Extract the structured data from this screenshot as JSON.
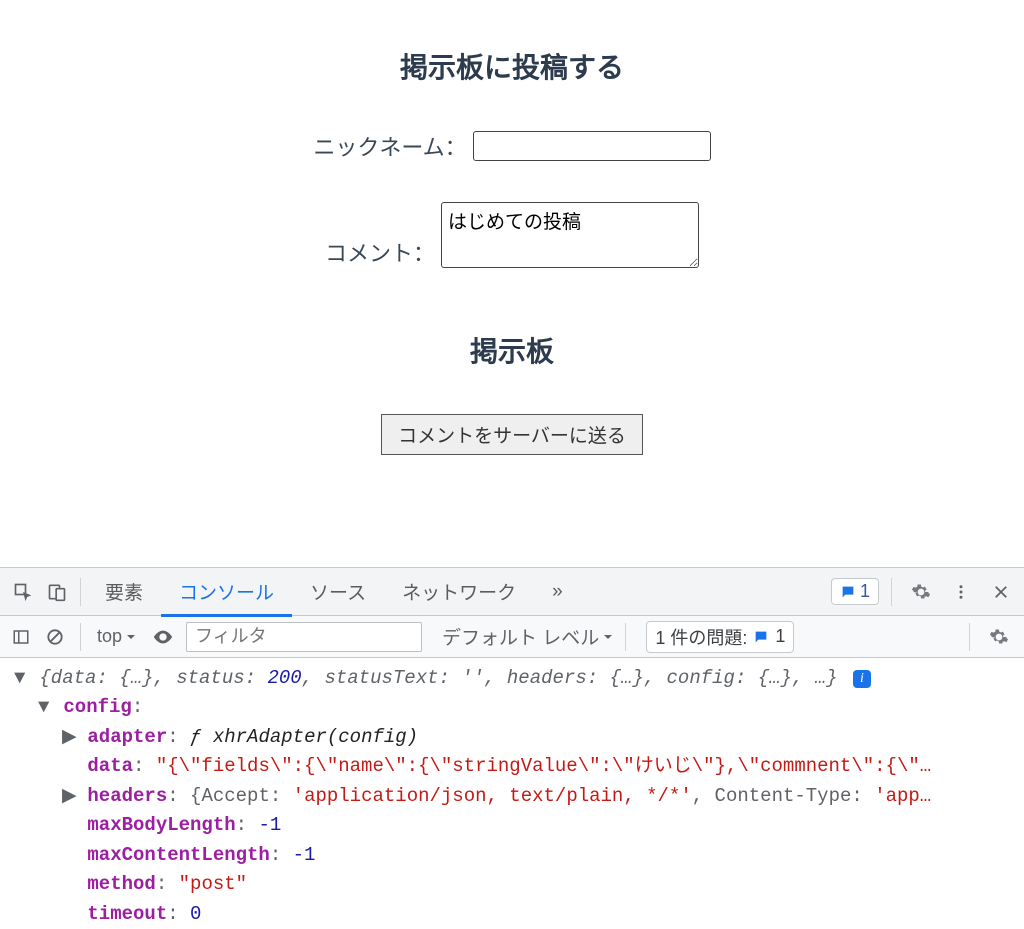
{
  "page": {
    "heading_post": "掲示板に投稿する",
    "nickname_label": "ニックネーム：",
    "nickname_value": "",
    "comment_label": "コメント：",
    "comment_value": "はじめての投稿",
    "heading_board": "掲示板",
    "submit_label": "コメントをサーバーに送る"
  },
  "devtools": {
    "tabs": {
      "elements": "要素",
      "console": "コンソール",
      "sources": "ソース",
      "network": "ネットワーク",
      "more": "»"
    },
    "badge_count": "1",
    "subbar": {
      "context": "top",
      "filter_placeholder": "フィルタ",
      "level": "デフォルト レベル",
      "issues_label": "1 件の問題:",
      "issues_count": "1"
    }
  },
  "console": {
    "line_top_prefix": "{data: {…}, status: ",
    "status": "200",
    "line_top_mid": ", statusText: '', headers: {…}, config: {…}, …}",
    "config_key": "config",
    "adapter_key": "adapter",
    "adapter_val": "ƒ xhrAdapter(config)",
    "data_key": "data",
    "data_val": "\"{\\\"fields\\\":{\\\"name\\\":{\\\"stringValue\\\":\\\"けいじ\\\"},\\\"commnent\\\":{\\\"…",
    "headers_key": "headers",
    "headers_open": "{",
    "headers_accept_k": "Accept: ",
    "headers_accept_v": "'application/json, text/plain, */*'",
    "headers_ct_k": ", Content-Type: ",
    "headers_ct_v": "'app…",
    "maxBodyLength_key": "maxBodyLength",
    "maxBodyLength_val": "-1",
    "maxContentLength_key": "maxContentLength",
    "maxContentLength_val": "-1",
    "method_key": "method",
    "method_val": "\"post\"",
    "timeout_key": "timeout",
    "timeout_val": "0"
  }
}
